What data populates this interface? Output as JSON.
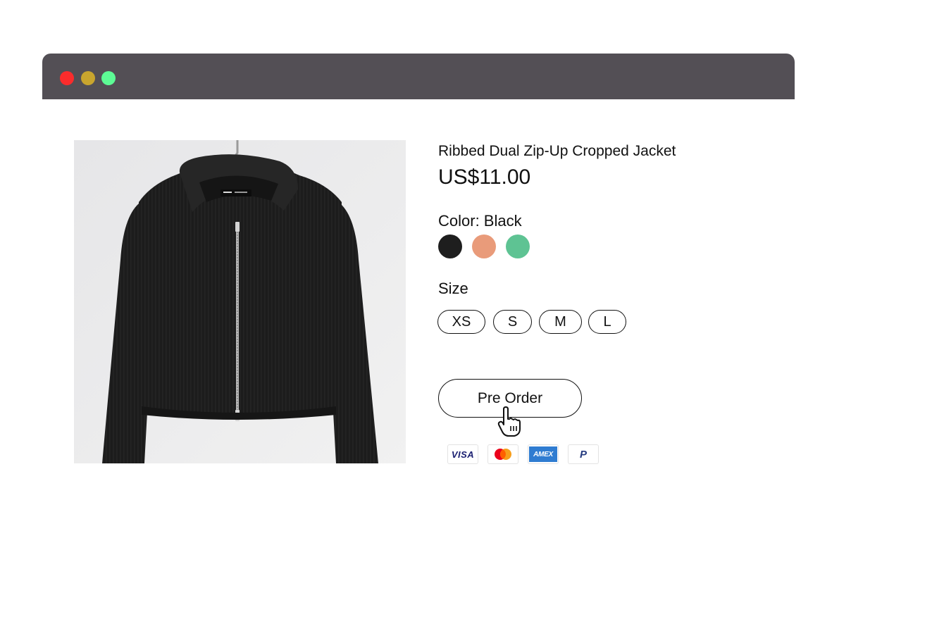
{
  "window": {
    "controls": [
      "close",
      "minimize",
      "maximize"
    ]
  },
  "product": {
    "title": "Ribbed Dual Zip-Up Cropped Jacket",
    "price": "US$11.00",
    "color_label": "Color: Black",
    "colors": [
      {
        "name": "Black",
        "hex": "#1e1e1e"
      },
      {
        "name": "Peach",
        "hex": "#e99b7a"
      },
      {
        "name": "Green",
        "hex": "#5ec393"
      }
    ],
    "size_label": "Size",
    "sizes": [
      "XS",
      "S",
      "M",
      "L"
    ],
    "preorder_label": "Pre Order"
  },
  "payments": [
    {
      "name": "visa-icon",
      "label": "VISA"
    },
    {
      "name": "mastercard-icon",
      "label": ""
    },
    {
      "name": "amex-icon",
      "label": "AMEX"
    },
    {
      "name": "paypal-icon",
      "label": "P"
    }
  ],
  "colors": {
    "titlebar": "#534f55",
    "close": "#fb2c2c",
    "minimize": "#c9a52e",
    "maximize": "#5dfb95"
  }
}
